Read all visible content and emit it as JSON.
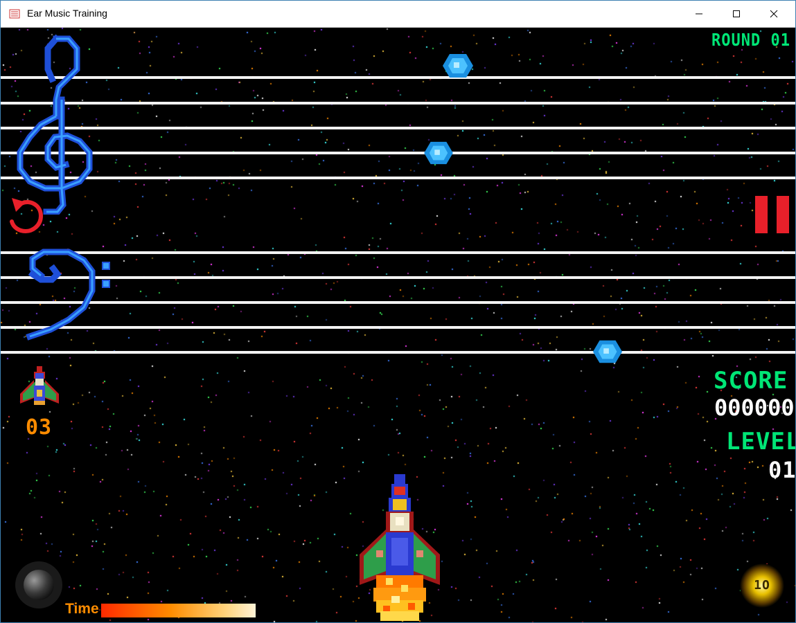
{
  "window": {
    "title": "Ear Music Training"
  },
  "hud": {
    "round_text": "ROUND 01",
    "score_label": "SCORE",
    "score_value": "000000",
    "level_label": "LEVEL",
    "level_value": "01",
    "lives_value": "03",
    "time_label": "Time",
    "time_remaining_fraction": 1.0,
    "boom_text": "1O"
  },
  "icons": {
    "treble_clef": "treble-clef-icon",
    "bass_clef": "bass-clef-icon",
    "undo": "undo-icon",
    "pause": "pause-icon",
    "player_ship": "spaceship-icon",
    "life_ship": "life-ship-icon",
    "note": "note-gem-icon",
    "joystick": "joystick-icon",
    "boom": "boom-button-icon"
  },
  "colors": {
    "staff_line": "#f2f2f2",
    "hud_green": "#00e676",
    "hud_orange": "#ff8c00",
    "control_red": "#e8202a",
    "clef_blue": "#2a6bff",
    "note_blue": "#2aa8ff"
  }
}
